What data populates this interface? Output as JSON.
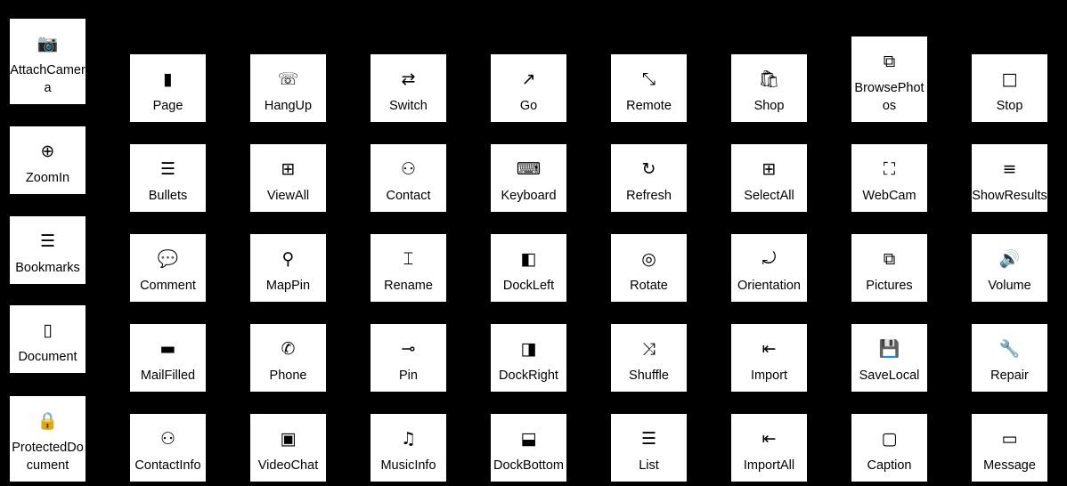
{
  "colors": {
    "background": "#000000",
    "tile": "#ffffff",
    "text": "#000000"
  },
  "left_column": [
    {
      "label": "AttachCamera",
      "icon": "attach-camera-icon",
      "tall": true
    },
    {
      "label": "ZoomIn",
      "icon": "zoom-in-icon"
    },
    {
      "label": "Bookmarks",
      "icon": "bookmarks-icon"
    },
    {
      "label": "Document",
      "icon": "document-icon"
    },
    {
      "label": "ProtectedDocument",
      "icon": "protected-document-icon",
      "tall": true
    }
  ],
  "grid": [
    [
      {
        "label": "Page",
        "icon": "page-icon"
      },
      {
        "label": "HangUp",
        "icon": "hang-up-icon"
      },
      {
        "label": "Switch",
        "icon": "switch-icon"
      },
      {
        "label": "Go",
        "icon": "go-icon"
      },
      {
        "label": "Remote",
        "icon": "remote-icon"
      },
      {
        "label": "Shop",
        "icon": "shop-icon"
      },
      {
        "label": "BrowsePhotos",
        "icon": "browse-photos-icon",
        "tall": true
      },
      {
        "label": "Stop",
        "icon": "stop-icon"
      }
    ],
    [
      {
        "label": "Bullets",
        "icon": "bullets-icon"
      },
      {
        "label": "ViewAll",
        "icon": "view-all-icon"
      },
      {
        "label": "Contact",
        "icon": "contact-icon"
      },
      {
        "label": "Keyboard",
        "icon": "keyboard-icon"
      },
      {
        "label": "Refresh",
        "icon": "refresh-icon"
      },
      {
        "label": "SelectAll",
        "icon": "select-all-icon"
      },
      {
        "label": "WebCam",
        "icon": "webcam-icon"
      },
      {
        "label": "ShowResults",
        "icon": "show-results-icon"
      }
    ],
    [
      {
        "label": "Comment",
        "icon": "comment-icon"
      },
      {
        "label": "MapPin",
        "icon": "map-pin-icon"
      },
      {
        "label": "Rename",
        "icon": "rename-icon"
      },
      {
        "label": "DockLeft",
        "icon": "dock-left-icon"
      },
      {
        "label": "Rotate",
        "icon": "rotate-icon"
      },
      {
        "label": "Orientation",
        "icon": "orientation-icon"
      },
      {
        "label": "Pictures",
        "icon": "pictures-icon"
      },
      {
        "label": "Volume",
        "icon": "volume-icon"
      }
    ],
    [
      {
        "label": "MailFilled",
        "icon": "mail-filled-icon"
      },
      {
        "label": "Phone",
        "icon": "phone-icon"
      },
      {
        "label": "Pin",
        "icon": "pin-icon"
      },
      {
        "label": "DockRight",
        "icon": "dock-right-icon"
      },
      {
        "label": "Shuffle",
        "icon": "shuffle-icon"
      },
      {
        "label": "Import",
        "icon": "import-icon"
      },
      {
        "label": "SaveLocal",
        "icon": "save-local-icon"
      },
      {
        "label": "Repair",
        "icon": "repair-icon"
      }
    ],
    [
      {
        "label": "ContactInfo",
        "icon": "contact-info-icon"
      },
      {
        "label": "VideoChat",
        "icon": "video-chat-icon"
      },
      {
        "label": "MusicInfo",
        "icon": "music-info-icon"
      },
      {
        "label": "DockBottom",
        "icon": "dock-bottom-icon"
      },
      {
        "label": "List",
        "icon": "list-icon"
      },
      {
        "label": "ImportAll",
        "icon": "import-all-icon"
      },
      {
        "label": "Caption",
        "icon": "caption-icon"
      },
      {
        "label": "Message",
        "icon": "message-icon"
      }
    ]
  ]
}
